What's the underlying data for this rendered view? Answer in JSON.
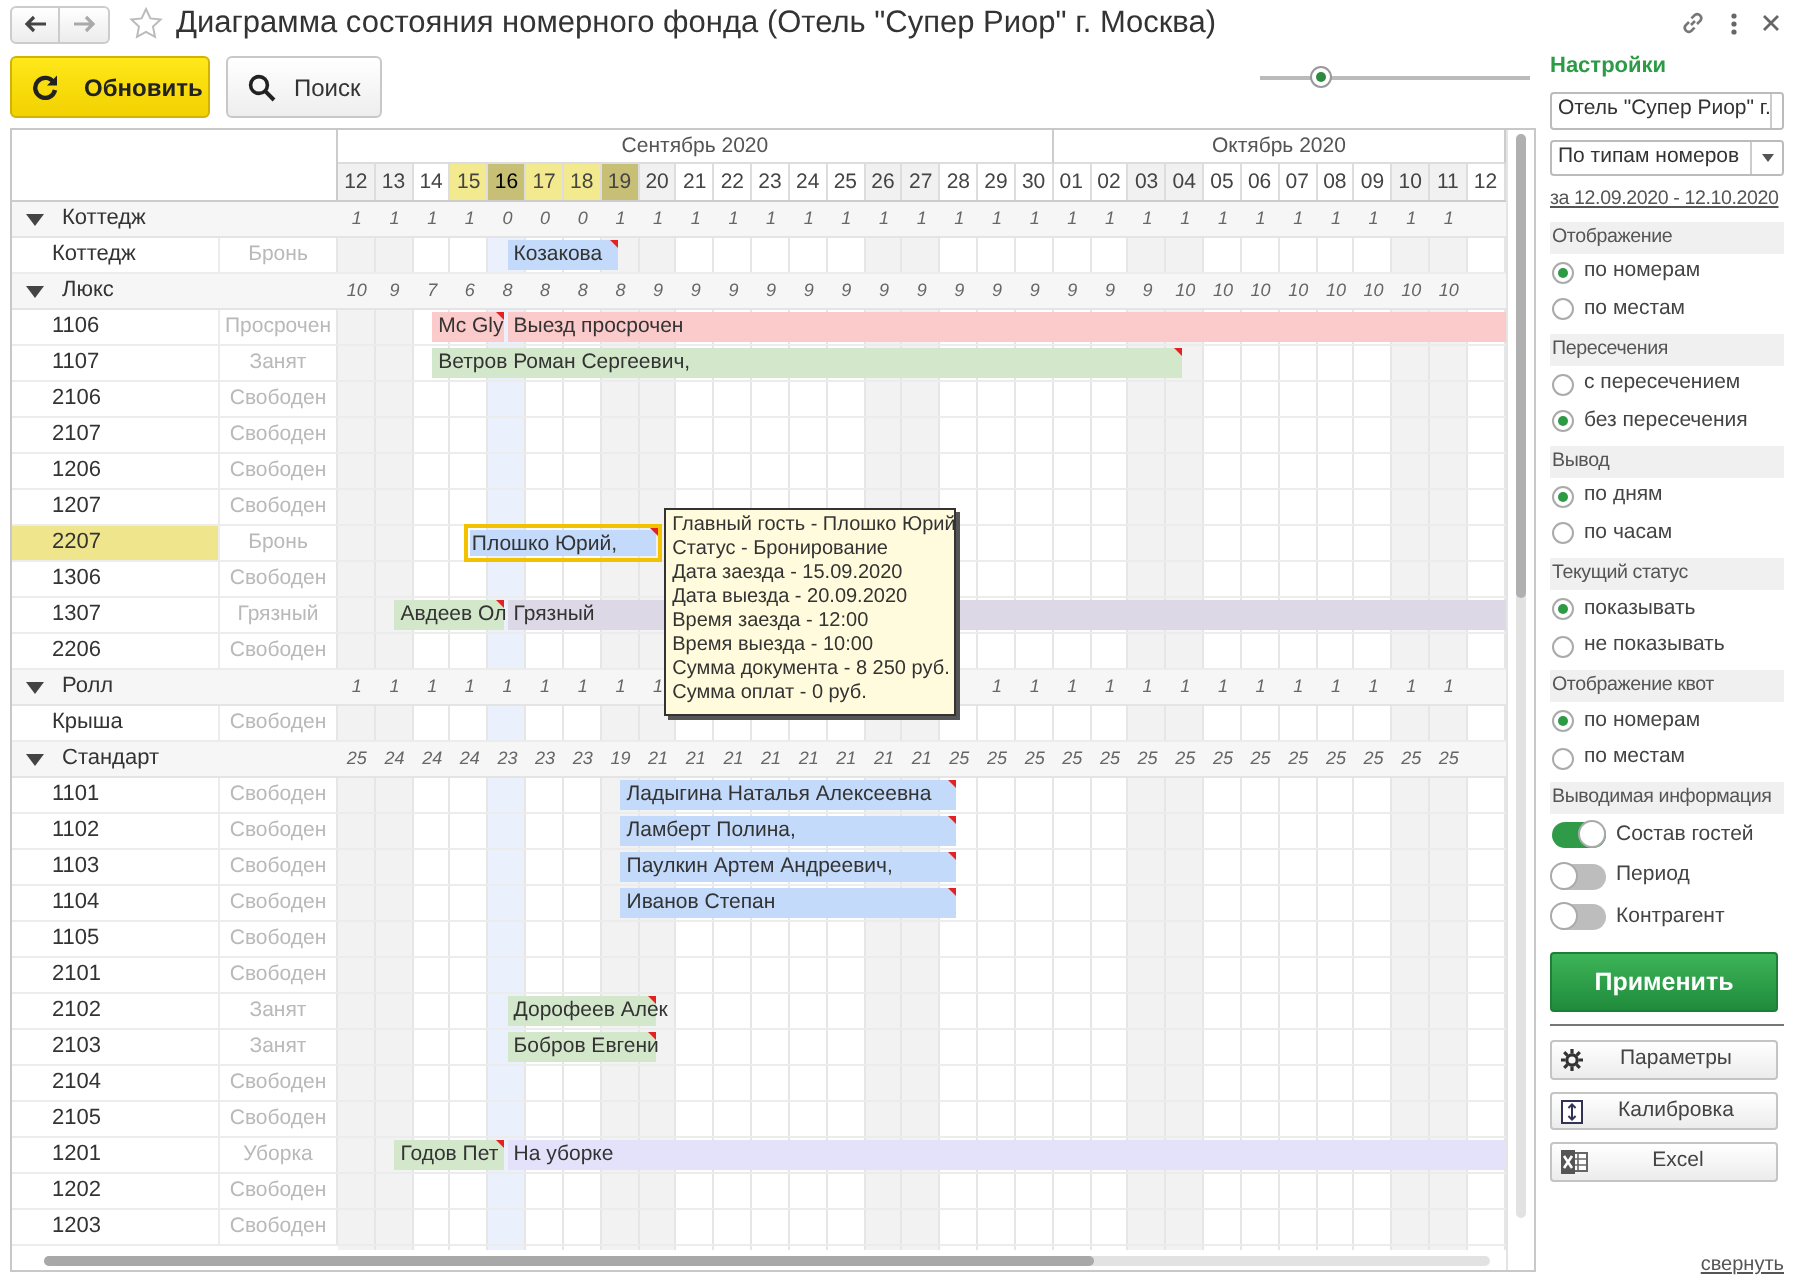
{
  "window": {
    "title": "Диаграмма состояния номерного фонда (Отель \"Супер Риор\" г. Москва)"
  },
  "toolbar": {
    "buttons": [
      {
        "label": "Обновить",
        "kind": "refresh",
        "primary": true
      },
      {
        "label": "Поиск",
        "kind": "search",
        "primary": false
      }
    ],
    "zoom_slider": {
      "level": 0.22
    }
  },
  "grid": {
    "months": [
      {
        "label": "Сентябрь 2020",
        "days": [
          {
            "label": "12",
            "weekend": true,
            "current": false,
            "selected": false
          },
          {
            "label": "13",
            "weekend": true,
            "current": false,
            "selected": false
          },
          {
            "label": "14",
            "weekend": false,
            "current": false,
            "selected": false
          },
          {
            "label": "15",
            "weekend": false,
            "current": false,
            "selected": true
          },
          {
            "label": "16",
            "weekend": false,
            "current": true,
            "selected": true
          },
          {
            "label": "17",
            "weekend": false,
            "current": false,
            "selected": true
          },
          {
            "label": "18",
            "weekend": false,
            "current": false,
            "selected": true
          },
          {
            "label": "19",
            "weekend": true,
            "current": false,
            "selected": true
          },
          {
            "label": "20",
            "weekend": true,
            "current": false,
            "selected": false
          },
          {
            "label": "21",
            "weekend": false,
            "current": false,
            "selected": false
          },
          {
            "label": "22",
            "weekend": false,
            "current": false,
            "selected": false
          },
          {
            "label": "23",
            "weekend": false,
            "current": false,
            "selected": false
          },
          {
            "label": "24",
            "weekend": false,
            "current": false,
            "selected": false
          },
          {
            "label": "25",
            "weekend": false,
            "current": false,
            "selected": false
          },
          {
            "label": "26",
            "weekend": true,
            "current": false,
            "selected": false
          },
          {
            "label": "27",
            "weekend": true,
            "current": false,
            "selected": false
          },
          {
            "label": "28",
            "weekend": false,
            "current": false,
            "selected": false
          },
          {
            "label": "29",
            "weekend": false,
            "current": false,
            "selected": false
          },
          {
            "label": "30",
            "weekend": false,
            "current": false,
            "selected": false
          }
        ]
      },
      {
        "label": "Октябрь 2020",
        "days": [
          {
            "label": "01",
            "weekend": false,
            "current": false,
            "selected": false
          },
          {
            "label": "02",
            "weekend": false,
            "current": false,
            "selected": false
          },
          {
            "label": "03",
            "weekend": true,
            "current": false,
            "selected": false
          },
          {
            "label": "04",
            "weekend": true,
            "current": false,
            "selected": false
          },
          {
            "label": "05",
            "weekend": false,
            "current": false,
            "selected": false
          },
          {
            "label": "06",
            "weekend": false,
            "current": false,
            "selected": false
          },
          {
            "label": "07",
            "weekend": false,
            "current": false,
            "selected": false
          },
          {
            "label": "08",
            "weekend": false,
            "current": false,
            "selected": false
          },
          {
            "label": "09",
            "weekend": false,
            "current": false,
            "selected": false
          },
          {
            "label": "10",
            "weekend": true,
            "current": false,
            "selected": false
          },
          {
            "label": "11",
            "weekend": true,
            "current": false,
            "selected": false
          },
          {
            "label": "12",
            "weekend": false,
            "current": false,
            "selected": false
          }
        ]
      }
    ],
    "groups": [
      {
        "name": "Коттедж",
        "expanded": true,
        "counts": [
          "1",
          "1",
          "1",
          "1",
          "0",
          "0",
          "0",
          "1",
          "1",
          "1",
          "1",
          "1",
          "1",
          "1",
          "1",
          "1",
          "1",
          "1",
          "1",
          "1",
          "1",
          "1",
          "1",
          "1",
          "1",
          "1",
          "1",
          "1",
          "1",
          "1"
        ],
        "rooms": [
          {
            "number": "Коттедж",
            "status": "Бронь",
            "selected": false,
            "bars": [
              {
                "text": "Козакова",
                "kind": "booking",
                "flag": true,
                "selected": false
              }
            ]
          }
        ]
      },
      {
        "name": "Люкс",
        "expanded": true,
        "counts": [
          "10",
          "9",
          "7",
          "6",
          "8",
          "8",
          "8",
          "8",
          "9",
          "9",
          "9",
          "9",
          "9",
          "9",
          "9",
          "9",
          "9",
          "9",
          "9",
          "9",
          "9",
          "9",
          "10",
          "10",
          "10",
          "10",
          "10",
          "10",
          "10",
          "10"
        ],
        "rooms": [
          {
            "number": "1106",
            "status": "Просрочен",
            "selected": false,
            "bars": [
              {
                "text": "Mc Gly",
                "kind": "overdue",
                "flag": true,
                "selected": false
              },
              {
                "text": "Выезд просрочен",
                "kind": "overdue",
                "flag": false,
                "selected": false
              }
            ]
          },
          {
            "number": "1107",
            "status": "Занят",
            "selected": false,
            "bars": [
              {
                "text": "Ветров Роман Сергеевич,",
                "kind": "occupied",
                "flag": true,
                "selected": false
              }
            ]
          },
          {
            "number": "2106",
            "status": "Свободен",
            "selected": false
          },
          {
            "number": "2107",
            "status": "Свободен",
            "selected": false
          },
          {
            "number": "1206",
            "status": "Свободен",
            "selected": false
          },
          {
            "number": "1207",
            "status": "Свободен",
            "selected": false
          },
          {
            "number": "2207",
            "status": "Бронь",
            "selected": true,
            "bars": [
              {
                "text": "Плошко Юрий,",
                "kind": "booking",
                "flag": true,
                "selected": true,
                "tooltip": [
                  "Главный гость - Плошко Юрий",
                  "Статус - Бронирование",
                  "Дата заезда - 15.09.2020",
                  "Дата выезда - 20.09.2020",
                  "Время заезда - 12:00",
                  "Время выезда - 10:00",
                  "Сумма документа - 8 250 руб.",
                  "Сумма оплат - 0 руб."
                ]
              }
            ]
          },
          {
            "number": "1306",
            "status": "Свободен",
            "selected": false
          },
          {
            "number": "1307",
            "status": "Грязный",
            "selected": false,
            "bars": [
              {
                "text": "Авдеев Ол",
                "kind": "occupied",
                "flag": true,
                "selected": false
              },
              {
                "text": "Грязный",
                "kind": "dirty",
                "flag": false,
                "selected": false
              }
            ]
          },
          {
            "number": "2206",
            "status": "Свободен",
            "selected": false
          }
        ]
      },
      {
        "name": "Ролл",
        "expanded": true,
        "counts": [
          "1",
          "1",
          "1",
          "1",
          "1",
          "1",
          "1",
          "1",
          "1"
        ],
        "counts_after_tooltip": [
          "1",
          "1",
          "1",
          "1",
          "1",
          "1",
          "1",
          "1",
          "1",
          "1",
          "1",
          "1",
          "1"
        ],
        "rooms": [
          {
            "number": "Крыша",
            "status": "Свободен",
            "selected": false
          }
        ]
      },
      {
        "name": "Стандарт",
        "expanded": true,
        "counts": [
          "25",
          "24",
          "24",
          "24",
          "23",
          "23",
          "23",
          "19",
          "21",
          "21",
          "21",
          "21",
          "21",
          "21",
          "21",
          "21",
          "25",
          "25",
          "25",
          "25",
          "25",
          "25",
          "25",
          "25",
          "25",
          "25",
          "25",
          "25",
          "25",
          "25"
        ],
        "rooms": [
          {
            "number": "1101",
            "status": "Свободен",
            "selected": false,
            "bars": [
              {
                "text": "Ладыгина Наталья Алексеевна",
                "kind": "booking",
                "flag": true,
                "selected": false
              }
            ]
          },
          {
            "number": "1102",
            "status": "Свободен",
            "selected": false,
            "bars": [
              {
                "text": "Ламберт Полина,",
                "kind": "booking",
                "flag": true,
                "selected": false
              }
            ]
          },
          {
            "number": "1103",
            "status": "Свободен",
            "selected": false,
            "bars": [
              {
                "text": "Паулкин Артем Андреевич,",
                "kind": "booking",
                "flag": true,
                "selected": false
              }
            ]
          },
          {
            "number": "1104",
            "status": "Свободен",
            "selected": false,
            "bars": [
              {
                "text": "Иванов Степан",
                "kind": "booking",
                "flag": true,
                "selected": false
              }
            ]
          },
          {
            "number": "1105",
            "status": "Свободен",
            "selected": false
          },
          {
            "number": "2101",
            "status": "Свободен",
            "selected": false
          },
          {
            "number": "2102",
            "status": "Занят",
            "selected": false,
            "bars": [
              {
                "text": "Дорофеев Алек",
                "kind": "occupied",
                "flag": true,
                "selected": false
              }
            ]
          },
          {
            "number": "2103",
            "status": "Занят",
            "selected": false,
            "bars": [
              {
                "text": "Бобров Евгени",
                "kind": "occupied",
                "flag": true,
                "selected": false
              }
            ]
          },
          {
            "number": "2104",
            "status": "Свободен",
            "selected": false
          },
          {
            "number": "2105",
            "status": "Свободен",
            "selected": false
          },
          {
            "number": "1201",
            "status": "Уборка",
            "selected": false,
            "bars": [
              {
                "text": "Годов Пет",
                "kind": "occupied",
                "flag": true,
                "selected": false
              },
              {
                "text": "На уборке",
                "kind": "cleaning",
                "flag": false,
                "selected": false
              }
            ]
          },
          {
            "number": "1202",
            "status": "Свободен",
            "selected": false
          },
          {
            "number": "1203",
            "status": "Свободен",
            "selected": false
          }
        ]
      }
    ]
  },
  "settings": {
    "title": "Настройки",
    "selects": [
      {
        "value": "Отель \"Супер Риор\" г."
      },
      {
        "value": "По типам номеров"
      }
    ],
    "period": "за 12.09.2020 - 12.10.2020",
    "sections": [
      {
        "title": "Отображение",
        "kind": "radio",
        "options": [
          {
            "label": "по номерам",
            "selected": true
          },
          {
            "label": "по местам",
            "selected": false
          }
        ]
      },
      {
        "title": "Пересечения",
        "kind": "radio",
        "options": [
          {
            "label": "с пересечением",
            "selected": false
          },
          {
            "label": "без пересечения",
            "selected": true
          }
        ]
      },
      {
        "title": "Вывод",
        "kind": "radio",
        "options": [
          {
            "label": "по дням",
            "selected": true
          },
          {
            "label": "по часам",
            "selected": false
          }
        ]
      },
      {
        "title": "Текущий статус",
        "kind": "radio",
        "options": [
          {
            "label": "показывать",
            "selected": true
          },
          {
            "label": "не показывать",
            "selected": false
          }
        ]
      },
      {
        "title": "Отображение квот",
        "kind": "radio",
        "options": [
          {
            "label": "по номерам",
            "selected": true
          },
          {
            "label": "по местам",
            "selected": false
          }
        ]
      },
      {
        "title": "Выводимая информация",
        "kind": "toggle",
        "options": [
          {
            "label": "Состав гостей",
            "on": true
          },
          {
            "label": "Период",
            "on": false
          },
          {
            "label": "Контрагент",
            "on": false
          }
        ]
      }
    ],
    "apply": "Применить",
    "buttons": [
      {
        "label": "Параметры",
        "kind": "gear"
      },
      {
        "label": "Калибровка",
        "kind": "calibrate"
      },
      {
        "label": "Excel",
        "kind": "excel"
      }
    ],
    "collapse": "свернуть"
  }
}
